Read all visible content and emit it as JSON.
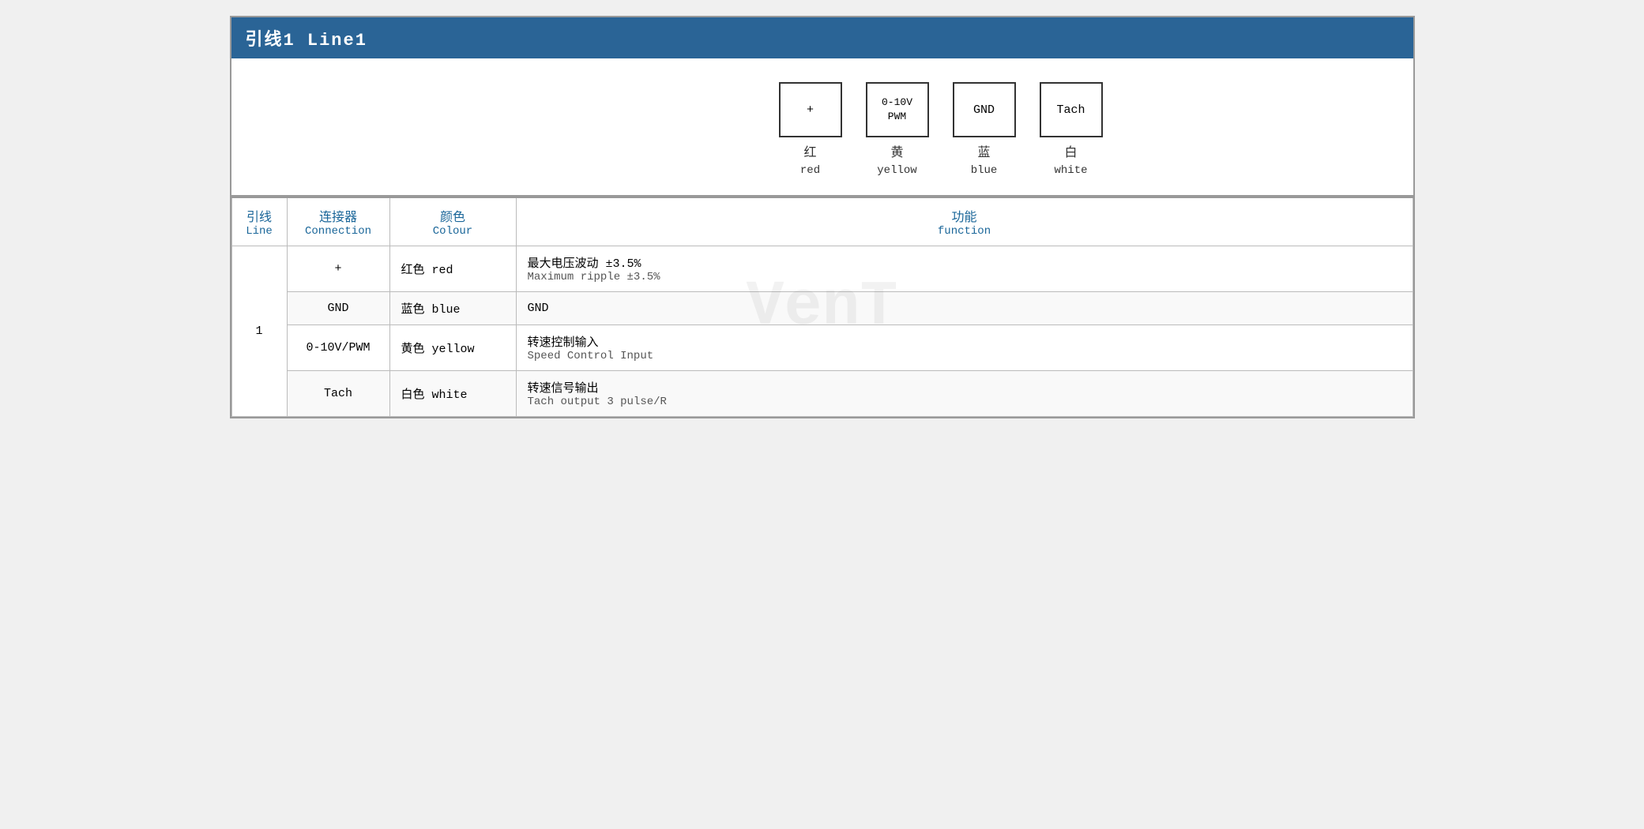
{
  "header": {
    "title": "引线1 Line1"
  },
  "diagram": {
    "pins": [
      {
        "id": "pin-plus",
        "symbol": "+",
        "zh": "红",
        "en": "red"
      },
      {
        "id": "pin-pwm",
        "symbol": "0-10V\nPWM",
        "zh": "黄",
        "en": "yellow"
      },
      {
        "id": "pin-gnd",
        "symbol": "GND",
        "zh": "蓝",
        "en": "blue"
      },
      {
        "id": "pin-tach",
        "symbol": "Tach",
        "zh": "白",
        "en": "white"
      }
    ]
  },
  "table": {
    "headers": {
      "line_zh": "引线",
      "line_en": "Line",
      "conn_zh": "连接器",
      "conn_en": "Connection",
      "color_zh": "颜色",
      "color_en": "Colour",
      "func_zh": "功能",
      "func_en": "function"
    },
    "rows": [
      {
        "line": "1",
        "connection": "+",
        "color_zh": "红色 red",
        "func_zh": "最大电压波动 ±3.5%",
        "func_en": "Maximum ripple ±3.5%",
        "rowspan": 4
      },
      {
        "connection": "GND",
        "color_zh": "蓝色 blue",
        "func_zh": "GND",
        "func_en": ""
      },
      {
        "connection": "0-10V/PWM",
        "color_zh": "黄色 yellow",
        "func_zh": "转速控制输入",
        "func_en": "Speed Control Input"
      },
      {
        "connection": "Tach",
        "color_zh": "白色 white",
        "func_zh": "转速信号输出",
        "func_en": "Tach output 3 pulse/R"
      }
    ]
  }
}
